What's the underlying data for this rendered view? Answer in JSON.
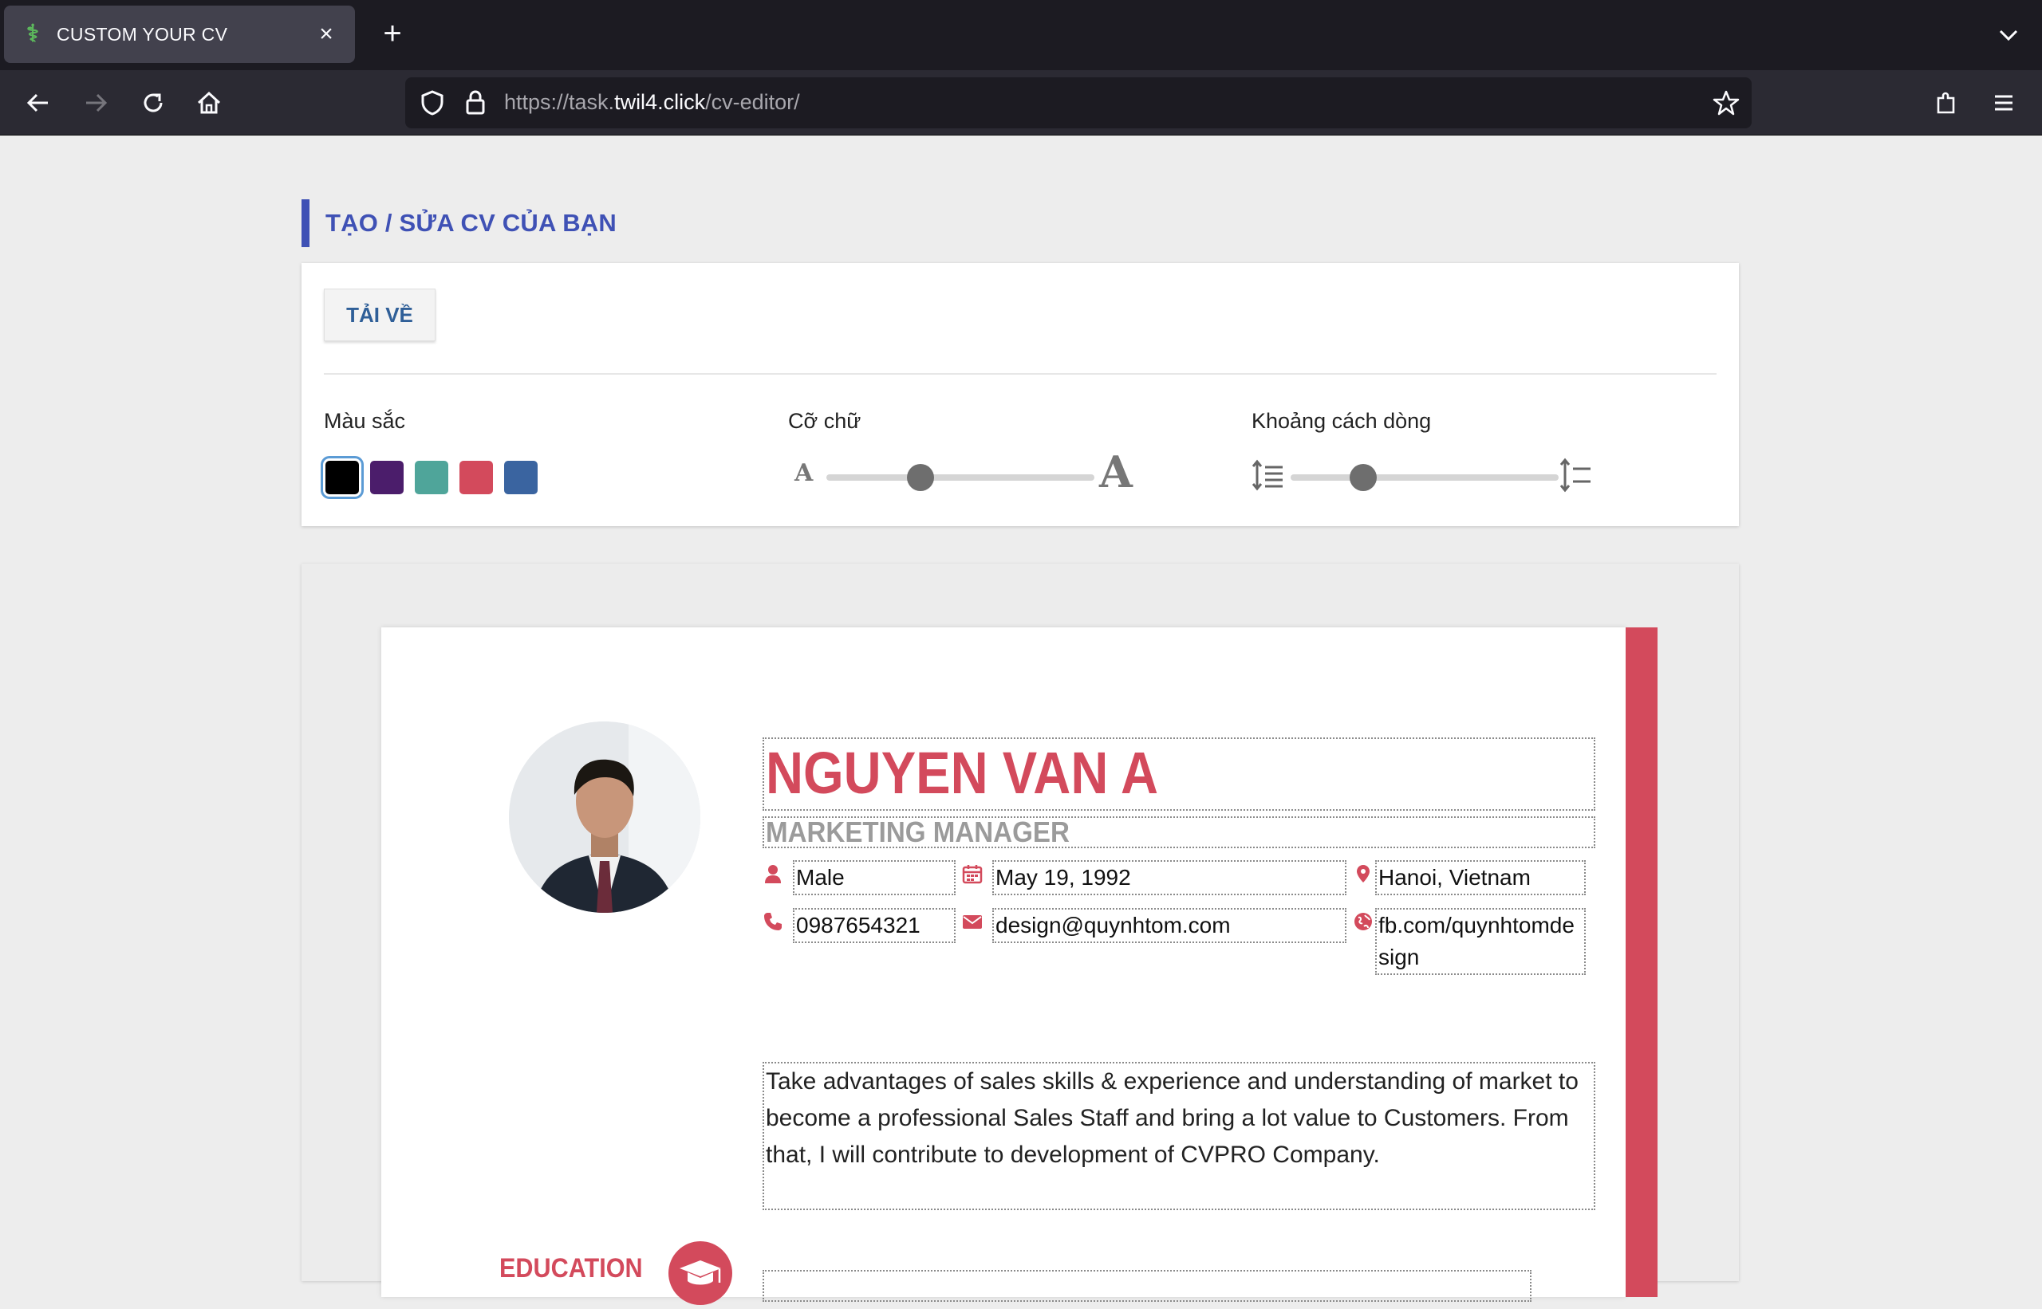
{
  "browser": {
    "tab_title": "CUSTOM YOUR CV",
    "url_prefix": "https://task.",
    "url_domain": "twil4.click",
    "url_path": "/cv-editor/"
  },
  "editor": {
    "heading": "TẠO / SỬA CV CỦA BẠN",
    "download_label": "TẢI VỀ",
    "color_label": "Màu sắc",
    "font_size_label": "Cỡ chữ",
    "line_height_label": "Khoảng cách dòng",
    "colors": [
      "#000000",
      "#4b1d6b",
      "#4fa59a",
      "#d34a5c",
      "#3a64a0"
    ],
    "selected_color": "#000000",
    "font_size_level": 0.35,
    "line_height_level": 0.27
  },
  "cv": {
    "accent": "#d34a5c",
    "name": "NGUYEN VAN A",
    "role": "MARKETING MANAGER",
    "gender": "Male",
    "birthday": "May 19, 1992",
    "address": "Hanoi, Vietnam",
    "phone": "0987654321",
    "email": "design@quynhtom.com",
    "website": "fb.com/quynhtomdesign",
    "summary": "Take advantages of sales skills & experience and understanding of market to become a professional Sales Staff and bring a lot value to Customers. From that, I will contribute to development of CVPRO Company.",
    "education_title": "EDUCATION"
  }
}
